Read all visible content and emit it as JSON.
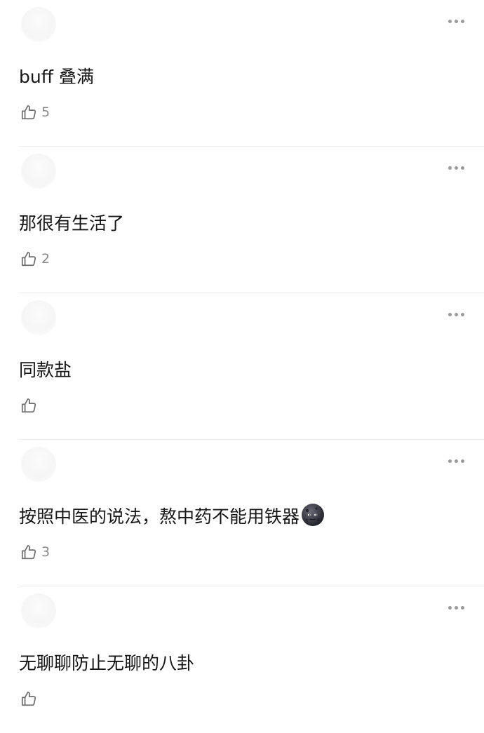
{
  "comments": [
    {
      "text": "buff 叠满",
      "likes": "5",
      "emoji": ""
    },
    {
      "text": "那很有生活了",
      "likes": "2",
      "emoji": ""
    },
    {
      "text": "同款盐",
      "likes": "",
      "emoji": ""
    },
    {
      "text": "按照中医的说法，熬中药不能用铁器",
      "likes": "3",
      "emoji": "new-moon-face-emoji"
    },
    {
      "text": "无聊聊防止无聊的八卦",
      "likes": "",
      "emoji": ""
    }
  ],
  "icons": {
    "like": "thumbs-up-outline-icon",
    "more": "more-dots-icon"
  },
  "colors": {
    "text": "#161616",
    "muted": "#8a8a8a",
    "divider": "#ececec",
    "dots": "#9a9a9a"
  }
}
